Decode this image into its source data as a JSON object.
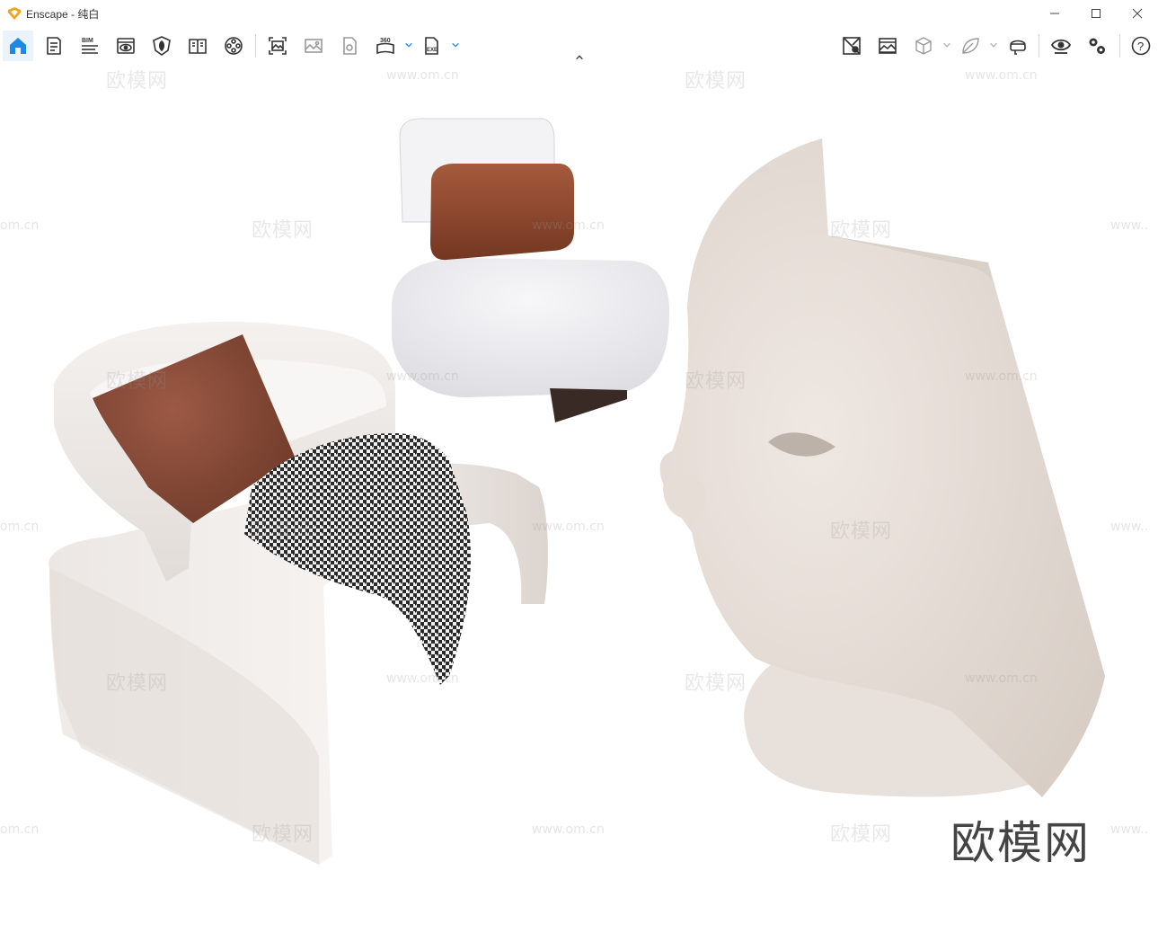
{
  "window": {
    "app_name": "Enscape",
    "separator": " - ",
    "document_name": "纯白",
    "accent_color": "#f7a21b"
  },
  "toolbar": {
    "left_buttons": [
      {
        "name": "home",
        "icon": "home-icon",
        "active": true
      },
      {
        "name": "project-info",
        "icon": "document-list-icon"
      },
      {
        "name": "bim",
        "icon": "bim-icon",
        "label": "BIM"
      },
      {
        "name": "views",
        "icon": "eye-window-icon"
      },
      {
        "name": "asset-library",
        "icon": "shield-leaf-icon"
      },
      {
        "name": "material-editor",
        "icon": "book-icon"
      },
      {
        "name": "video-editor",
        "icon": "film-reel-icon"
      },
      {
        "name": "screenshot",
        "icon": "capture-image-icon"
      },
      {
        "name": "batch-render",
        "icon": "image-stack-icon"
      },
      {
        "name": "export-panorama-file",
        "icon": "file-hand-icon"
      },
      {
        "name": "panorama",
        "icon": "panorama-360-icon",
        "label": "360"
      },
      {
        "name": "export-exe",
        "icon": "exe-file-icon",
        "label": "EXE"
      }
    ],
    "right_buttons": [
      {
        "name": "live-update",
        "icon": "sync-image-icon"
      },
      {
        "name": "capture-view",
        "icon": "landscape-icon"
      },
      {
        "name": "orthographic",
        "icon": "cube-icon"
      },
      {
        "name": "material-leaf",
        "icon": "leaf-icon"
      },
      {
        "name": "vr-headset",
        "icon": "vr-headset-icon"
      },
      {
        "name": "visual-settings",
        "icon": "eye-icon"
      },
      {
        "name": "general-settings",
        "icon": "gears-icon"
      },
      {
        "name": "help",
        "icon": "help-circle-icon",
        "label": "?"
      }
    ]
  },
  "watermark": {
    "brand_text": "欧模网",
    "url_text": "www.om.cn",
    "partial_url": "om.cn",
    "edge_url": "www.."
  },
  "scene": {
    "background": "#ffffff",
    "objects": [
      "armchair-with-pillow-and-throw",
      "lounge-chair-with-leather-cushion",
      "face-sculpture-chair"
    ]
  }
}
